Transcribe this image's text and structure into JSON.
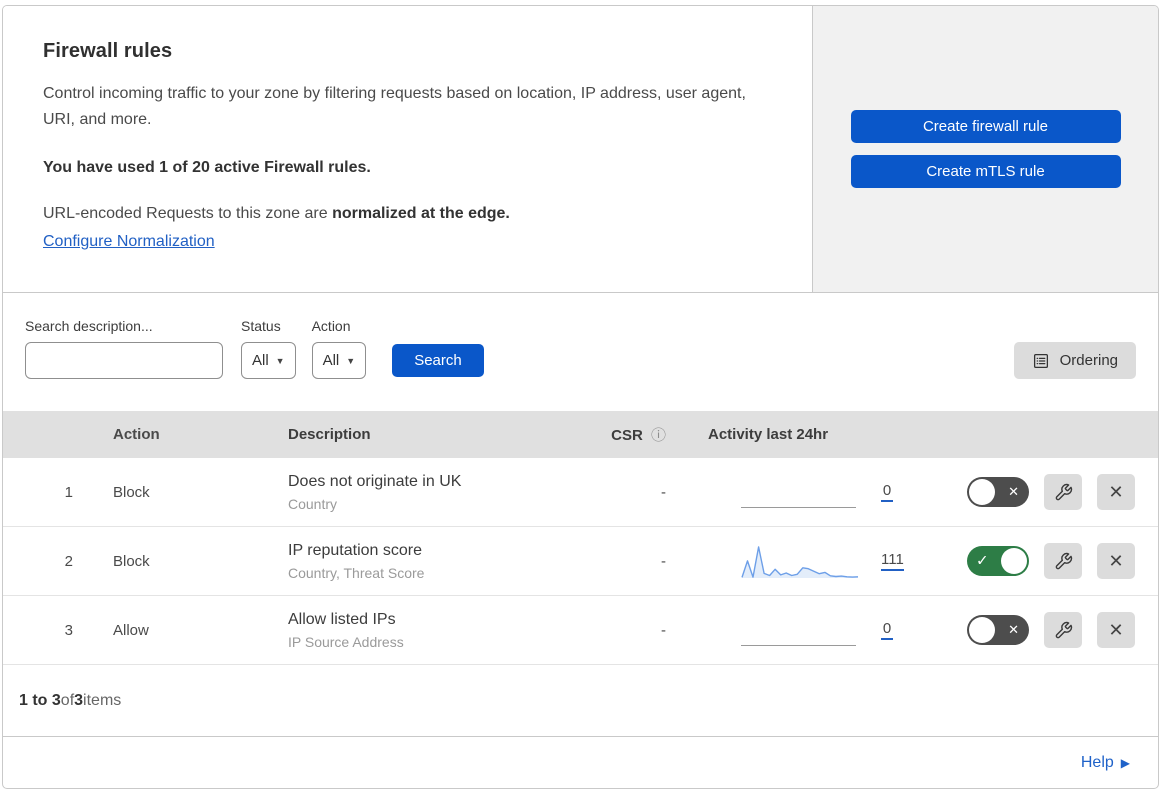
{
  "header": {
    "title": "Firewall rules",
    "description": "Control incoming traffic to your zone by filtering requests based on location, IP address, user agent, URI, and more.",
    "usage_line": "You have used 1 of 20 active Firewall rules.",
    "normalization_prefix": "URL-encoded Requests to this zone are ",
    "normalization_bold": "normalized at the edge.",
    "normalization_link": "Configure Normalization",
    "create_firewall_label": "Create firewall rule",
    "create_mtls_label": "Create mTLS rule"
  },
  "filters": {
    "search_label": "Search description...",
    "status_label": "Status",
    "status_value": "All",
    "action_label": "Action",
    "action_value": "All",
    "search_button": "Search",
    "ordering_button": "Ordering"
  },
  "table": {
    "columns": {
      "action": "Action",
      "description": "Description",
      "csr": "CSR",
      "activity": "Activity last 24hr"
    },
    "rows": [
      {
        "index": "1",
        "action": "Block",
        "description": "Does not originate in UK",
        "fields": "Country",
        "csr": "-",
        "count": "0",
        "enabled": false
      },
      {
        "index": "2",
        "action": "Block",
        "description": "IP reputation score",
        "fields": "Country, Threat Score",
        "csr": "-",
        "count": "111",
        "enabled": true
      },
      {
        "index": "3",
        "action": "Allow",
        "description": "Allow listed IPs",
        "fields": "IP Source Address",
        "csr": "-",
        "count": "0",
        "enabled": false
      }
    ]
  },
  "activity_sparkline": {
    "row_index": "2",
    "values": [
      2,
      55,
      3,
      100,
      15,
      8,
      28,
      10,
      16,
      8,
      12,
      33,
      30,
      22,
      14,
      18,
      7,
      5,
      6,
      4,
      3,
      4
    ]
  },
  "footer": {
    "range_bold": "1 to 3",
    "of_text": " of ",
    "total_bold": "3",
    "items_text": " items",
    "help_label": "Help"
  },
  "colors": {
    "primary_blue": "#0a57c9",
    "link_blue": "#2160c4",
    "toggle_on_green": "#2d7d46",
    "toggle_off_gray": "#4d4d4d",
    "panel_gray": "#f1f1f1",
    "table_header_gray": "#e0e0e0",
    "sparkline_stroke": "#6d9fe8",
    "sparkline_fill": "#e3edfa"
  }
}
